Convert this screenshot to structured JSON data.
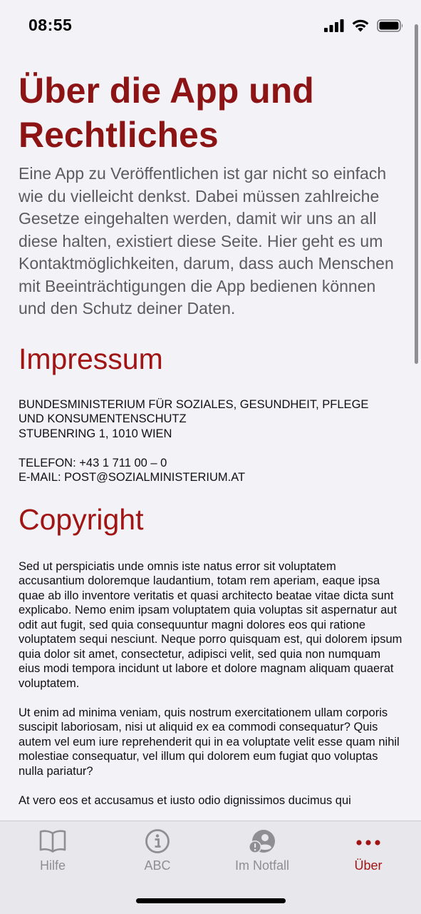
{
  "status_bar": {
    "time": "08:55"
  },
  "page": {
    "title": "Über die App und Rechtliches",
    "intro": "Eine App zu Veröffentlichen ist gar nicht so einfach wie du vielleicht denkst. Dabei müssen zahlreiche Gesetze eingehalten werden, damit wir uns an all diese halten, existiert diese Seite. Hier geht es um Kontaktmöglichkeiten, darum, dass auch Menschen mit Beeinträchtigungen die App bedienen können und den Schutz deiner Daten."
  },
  "impressum": {
    "heading": "Impressum",
    "org_line1": "Bundesministerium für Soziales, Gesundheit, Pflege",
    "org_line2": "und Konsumentenschutz",
    "address": "Stubenring 1, 1010 Wien",
    "phone": "Telefon: +43 1 711 00 – 0",
    "email": "E-Mail: post@sozialministerium.at"
  },
  "copyright": {
    "heading": "Copyright",
    "paragraphs": [
      "Sed ut perspiciatis unde omnis iste natus error sit voluptatem accusantium doloremque laudantium, totam rem aperiam, eaque ipsa quae ab illo inventore veritatis et quasi architecto beatae vitae dicta sunt explicabo. Nemo enim ipsam voluptatem quia voluptas sit aspernatur aut odit aut fugit, sed quia consequuntur magni dolores eos qui ratione voluptatem sequi nesciunt. Neque porro quisquam est, qui dolorem ipsum quia dolor sit amet, consectetur, adipisci velit, sed quia non numquam eius modi tempora incidunt ut labore et dolore magnam aliquam quaerat voluptatem.",
      "Ut enim ad minima veniam, quis nostrum exercitationem ullam corporis suscipit laboriosam, nisi ut aliquid ex ea commodi consequatur? Quis autem vel eum iure reprehenderit qui in ea voluptate velit esse quam nihil molestiae consequatur, vel illum qui dolorem eum fugiat quo voluptas nulla pariatur?",
      "At vero eos et accusamus et iusto odio dignissimos ducimus qui"
    ]
  },
  "tab_bar": {
    "tabs": [
      {
        "label": "Hilfe",
        "icon": "book-icon"
      },
      {
        "label": "ABC",
        "icon": "info-icon"
      },
      {
        "label": "Im Notfall",
        "icon": "person-alert-icon"
      },
      {
        "label": "Über",
        "icon": "more-dots-icon",
        "active": true
      }
    ]
  },
  "colors": {
    "accent": "#a11414",
    "title": "#8c1414",
    "background": "#f2f2f7",
    "tab_inactive": "#8e8e93"
  }
}
